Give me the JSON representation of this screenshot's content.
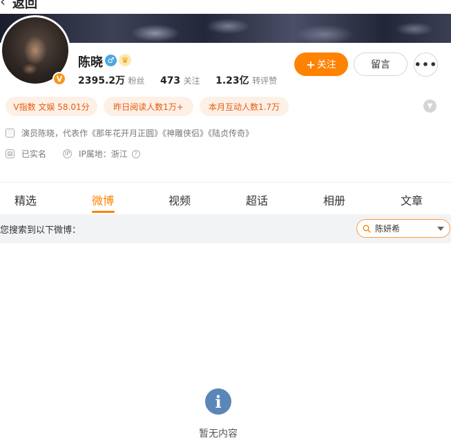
{
  "topbar": {
    "back_label": "返回"
  },
  "profile": {
    "name": "陈晓",
    "verified_icon": "V",
    "gender_icon": "♂",
    "crown_icon": "♛",
    "stats": [
      {
        "num": "2395.2万",
        "label": "粉丝"
      },
      {
        "num": "473",
        "label": "关注"
      },
      {
        "num": "1.23亿",
        "label": "转评赞"
      }
    ],
    "follow_plus": "+",
    "follow_label": "关注",
    "message_label": "留言",
    "more_label": "•••"
  },
  "tags": {
    "v_index": "V指数 文娱 58.01分",
    "yesterday_reads": "昨日阅读人数1万+",
    "month_interactions": "本月互动人数1.7万",
    "expand_icon": "▼"
  },
  "info": {
    "bio_icon": "♡",
    "bio": "演员陈晓，代表作《那年花开月正圆》《神雕侠侣》《陆贞传奇》",
    "realname_icon": "▤",
    "realname": "已实名",
    "ip_icon": "IP",
    "ip": "IP属地：浙江",
    "help_icon": "?"
  },
  "tabs": [
    {
      "label": "精选"
    },
    {
      "label": "微博"
    },
    {
      "label": "视频"
    },
    {
      "label": "超话"
    },
    {
      "label": "相册"
    },
    {
      "label": "文章"
    }
  ],
  "active_tab_index": 1,
  "filter": {
    "text": "您搜索到以下微博：",
    "search_value": "陈妍希"
  },
  "empty_state": {
    "icon": "i",
    "text": "暂无内容"
  },
  "colors": {
    "accent": "#ff8200",
    "tag_bg": "#fdf0e6",
    "tag_text": "#e85a0c",
    "info_icon": "#5b86b8"
  }
}
